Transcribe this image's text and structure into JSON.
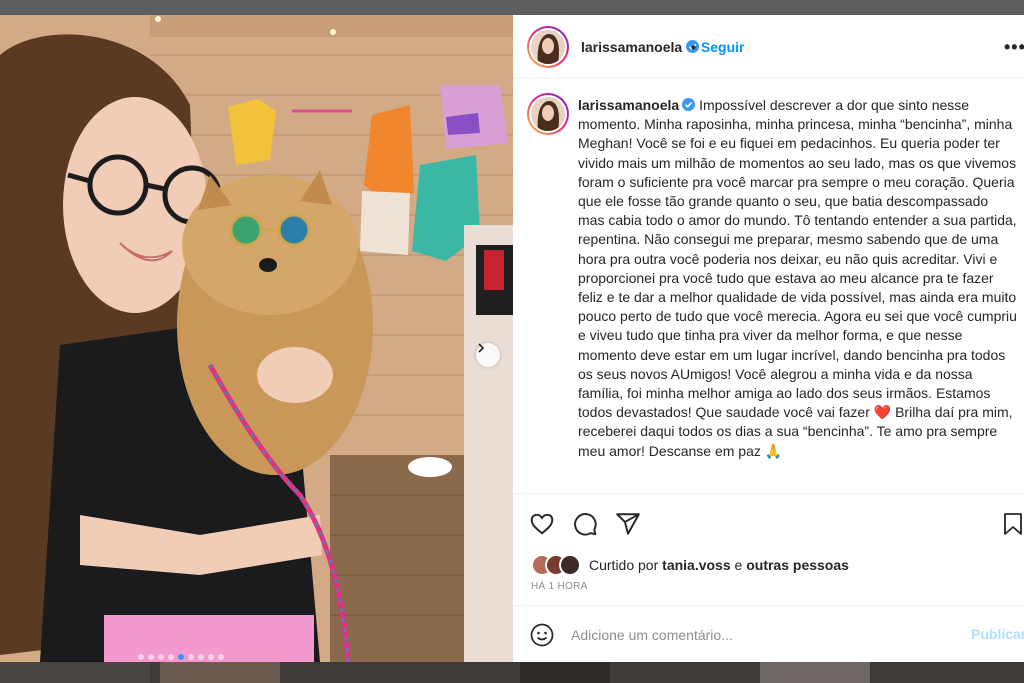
{
  "post": {
    "username": "larissamanoela",
    "follow_label": "Seguir",
    "separator": "•",
    "more_label": "•••",
    "caption": "Impossível descrever a dor que sinto nesse momento. Minha raposinha, minha princesa, minha “bencinha”, minha Meghan! Você se foi e eu fiquei em pedacinhos. Eu queria poder ter vivido mais um milhão de momentos ao seu lado, mas os que vivemos foram o suficiente pra você marcar pra sempre o meu coração. Queria que ele fosse tão grande quanto o seu, que batia descompassado mas cabia todo o amor do mundo. Tô tentando entender a sua partida, repentina. Não consegui me preparar, mesmo sabendo que de uma hora pra outra você poderia nos deixar, eu não quis acreditar. Vivi e proporcionei pra você tudo que estava ao meu alcance pra te fazer feliz e te dar a melhor qualidade de vida possível, mas ainda era muito pouco perto de tudo que você merecia. Agora eu sei que você cumpriu e viveu tudo que tinha pra viver da melhor forma, e que nesse momento deve estar em um lugar incrível, dando bencinha pra todos os seus novos AUmigos! Você alegrou a minha vida e da nossa família, foi minha melhor amiga ao lado dos seus irmãos. Estamos todos devastados! Que saudade você vai fazer",
    "caption_heart": "❤️",
    "caption_end": "Brilha daí pra mim, receberei daqui todos os dias a sua “bencinha”. Te amo pra sempre meu amor! Descanse em paz",
    "caption_emoji": "🙏",
    "likes_prefix": "Curtido por",
    "likes_user": "tania.voss",
    "likes_connector": "e",
    "likes_suffix": "outras pessoas",
    "timestamp": "HÁ 1 HORA",
    "comment_placeholder": "Adicione um comentário...",
    "post_label": "Publicar"
  },
  "carousel": {
    "slide_count": 9,
    "active_index": 4
  },
  "icons": {
    "like": "heart-icon",
    "comment": "comment-icon",
    "share": "share-icon",
    "save": "bookmark-icon",
    "emoji": "emoji-icon",
    "next": "chevron-right-icon",
    "verified": "verified-badge-icon"
  },
  "colors": {
    "accent": "#0095f6",
    "verified": "#3897f0",
    "muted": "#8e8e8e",
    "carousel_active": "#3897f0"
  }
}
